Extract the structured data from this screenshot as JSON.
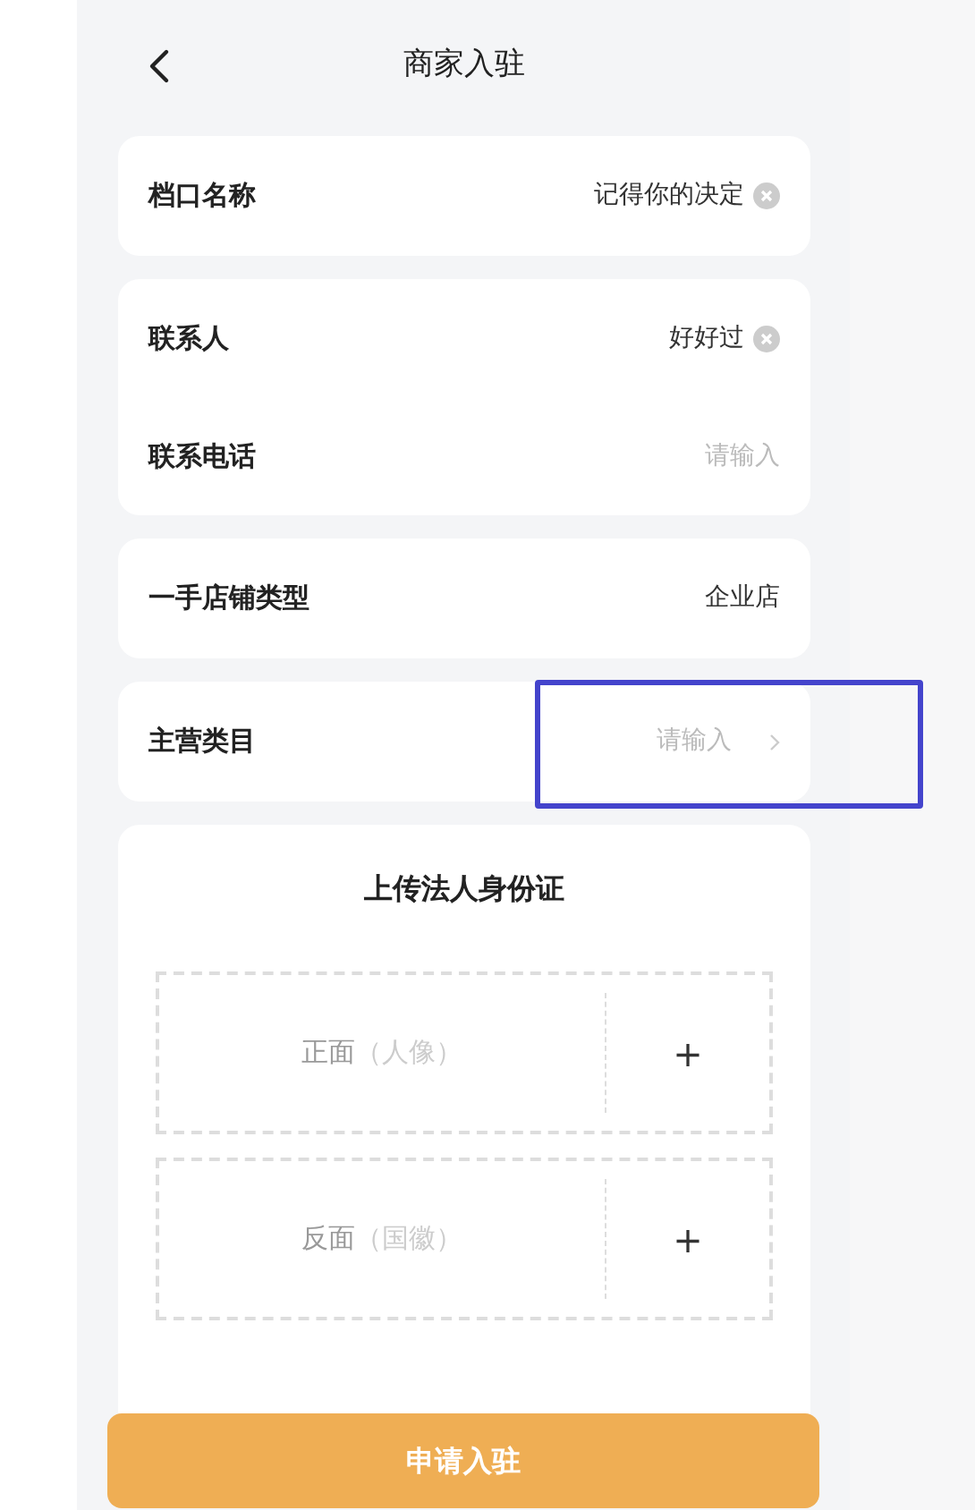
{
  "header": {
    "title": "商家入驻"
  },
  "groups": [
    {
      "rows": [
        {
          "kind": "input",
          "label": "档口名称",
          "value": "记得你的决定",
          "highlighted": false
        }
      ]
    },
    {
      "rows": [
        {
          "kind": "input",
          "label": "联系人",
          "value": "好好过",
          "highlighted": false
        },
        {
          "kind": "input",
          "label": "联系电话",
          "placeholder": "请输入",
          "highlighted": false
        }
      ]
    },
    {
      "rows": [
        {
          "kind": "static",
          "label": "一手店铺类型",
          "value": "企业店",
          "highlighted": false
        }
      ]
    },
    {
      "rows": [
        {
          "kind": "select",
          "label": "主营类目",
          "placeholder": "请输入",
          "highlighted": true
        }
      ]
    }
  ],
  "upload": {
    "title": "上传法人身份证",
    "slots": [
      {
        "side": "正面",
        "hint": "（人像）",
        "plus": "+"
      },
      {
        "side": "反面",
        "hint": "（国徽）",
        "plus": "+"
      }
    ]
  },
  "submit": "申请入驻"
}
